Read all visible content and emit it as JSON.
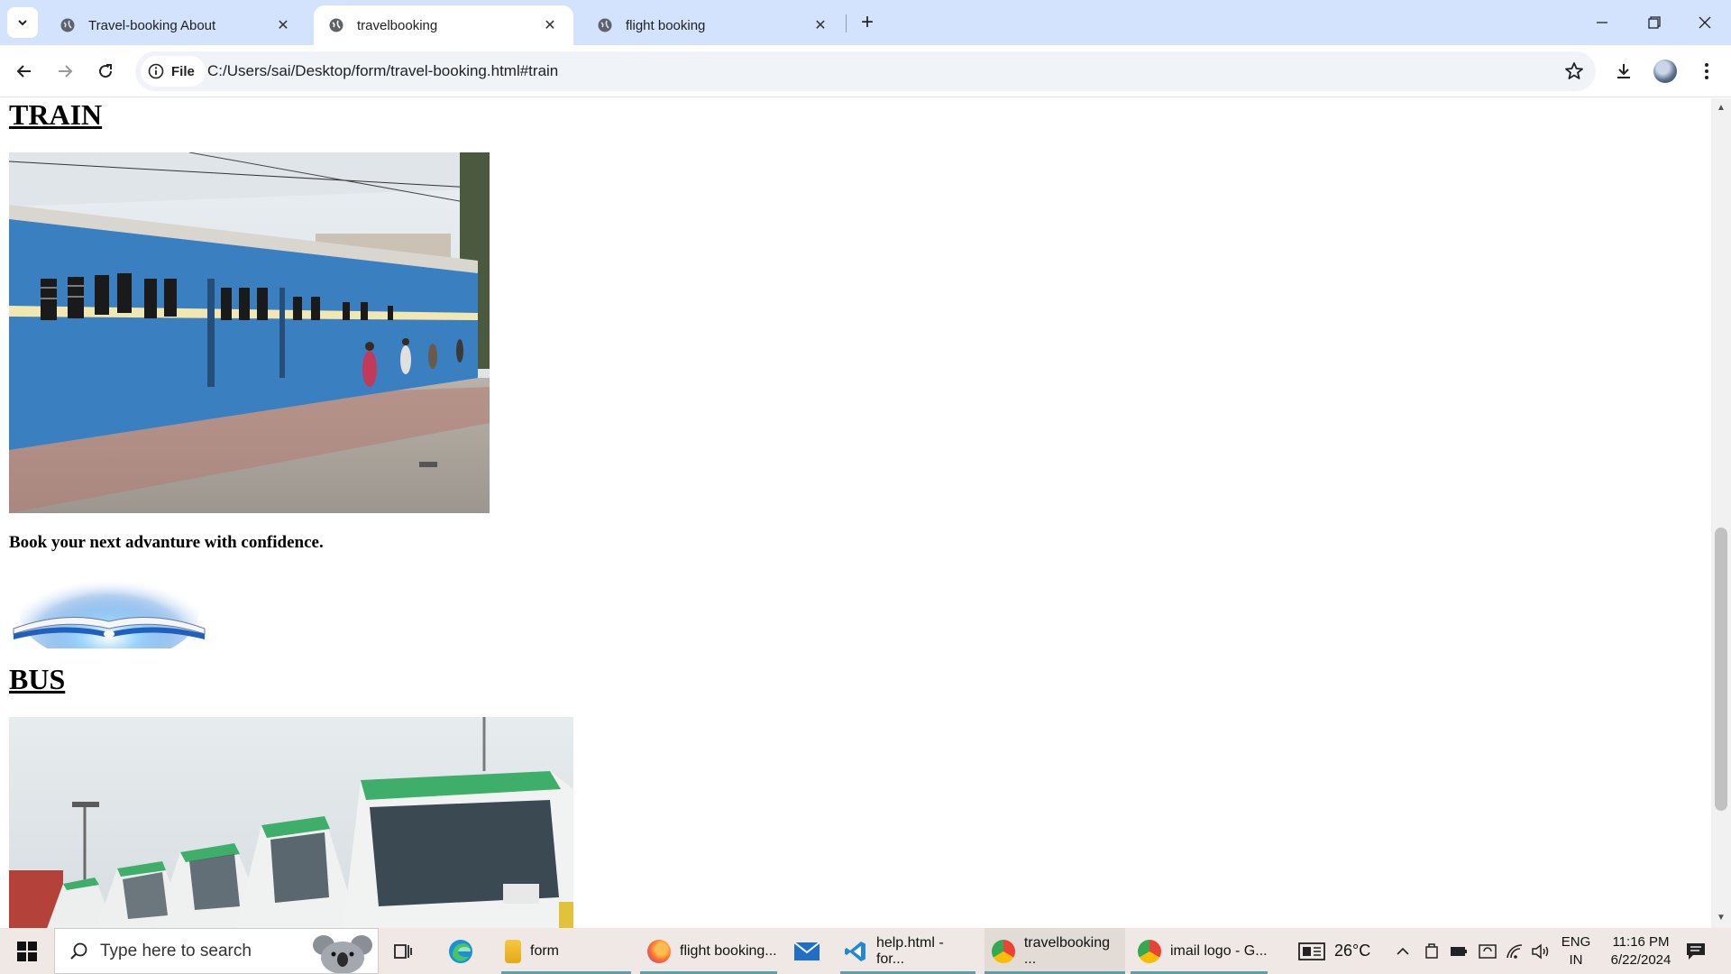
{
  "browser": {
    "tabs": [
      {
        "label": "Travel-booking About"
      },
      {
        "label": "travelbooking"
      },
      {
        "label": "flight booking"
      }
    ],
    "omnibox": {
      "chip_label": "File",
      "url": "C:/Users/sai/Desktop/form/travel-booking.html#train"
    }
  },
  "page": {
    "train_heading": "TRAIN",
    "tagline": "Book your next advanture with confidence.",
    "bus_heading": "BUS"
  },
  "taskbar": {
    "search_placeholder": "Type here to search",
    "apps": [
      {
        "label": "form"
      },
      {
        "label": "flight booking..."
      },
      {
        "label": "help.html - for..."
      },
      {
        "label": "travelbooking ..."
      },
      {
        "label": "imail logo - G..."
      }
    ],
    "weather": "26°C",
    "lang_line1": "ENG",
    "lang_line2": "IN",
    "time": "11:16 PM",
    "date": "6/22/2024"
  },
  "colors": {
    "tabstrip": "#d3e3fd",
    "taskbar": "#f0e8e4",
    "train_blue": "#3a7fc0",
    "bus_green": "#3fae6a"
  }
}
